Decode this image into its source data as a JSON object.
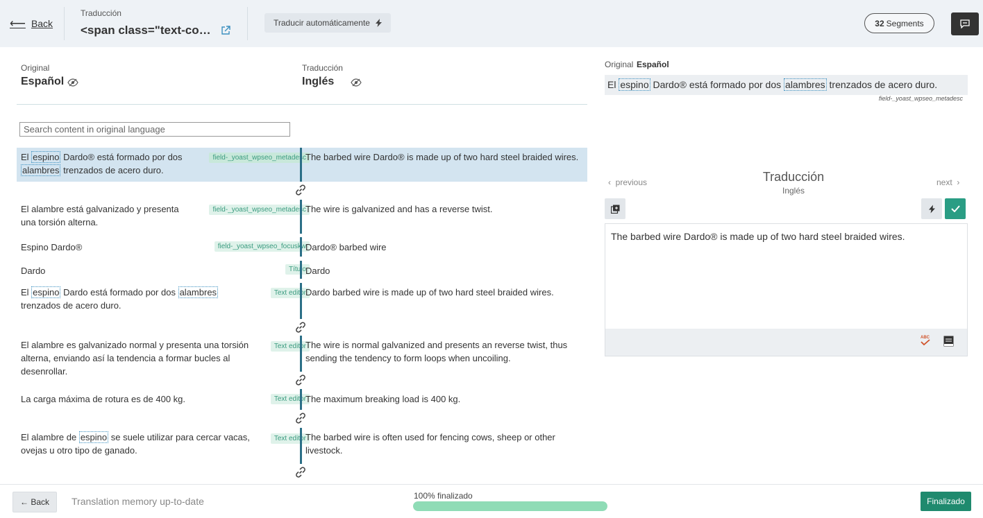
{
  "header": {
    "back_label": "Back",
    "title_small": "Traducción",
    "title_big": "<span class=\"text-copy\">Espino Dardo</span>",
    "auto_translate_label": "Traducir automáticamente",
    "segments_count": "32",
    "segments_label": "Segments"
  },
  "left": {
    "original_label": "Original",
    "original_lang": "Español",
    "translation_label": "Traducción",
    "translation_lang": "Inglés",
    "search_placeholder": "Search content in original language"
  },
  "segments": [
    {
      "src_parts": [
        "El ",
        "espino",
        " Dardo® está formado por dos ",
        "alambres",
        " trenzados de acero duro."
      ],
      "tag": "field-_yoast_wpseo_metadesc",
      "tgt": "The barbed wire Dardo® is made up of two hard steel braided wires."
    },
    {
      "src": "El alambre está galvanizado y presenta una torsión alterna.",
      "tag": "field-_yoast_wpseo_metadesc",
      "tgt": "The wire is galvanized and has a reverse twist."
    },
    {
      "src": "Espino Dardo®",
      "tag": "field-_yoast_wpseo_focuskw",
      "tgt": "Dardo® barbed wire"
    },
    {
      "src": "Dardo",
      "tag": "Título",
      "tgt": "Dardo"
    },
    {
      "src_parts": [
        "El ",
        "espino",
        " Dardo está formado por dos ",
        "alambres",
        " trenzados de acero duro."
      ],
      "tag": "Text editor",
      "tgt": "Dardo barbed wire is made up of two hard steel braided wires."
    },
    {
      "src": "El alambre es galvanizado normal y presenta una torsión alterna, enviando así la tendencia a formar bucles al desenrollar.",
      "tag": "Text editor",
      "tgt": "The wire is normal galvanized and presents an reverse twist, thus sending the tendency to form loops when uncoiling."
    },
    {
      "src": "La carga máxima de rotura es de 400 kg.",
      "tag": "Text editor",
      "tgt": "The maximum breaking load is 400 kg."
    },
    {
      "src_parts": [
        "El alambre de ",
        "espino",
        " se suele utilizar para cercar vacas, ovejas u otro tipo de ganado."
      ],
      "tag": "Text editor",
      "tgt": "The barbed wire is often used for fencing cows, sheep or other livestock."
    }
  ],
  "right": {
    "original_label": "Original",
    "original_lang": "Español",
    "original_parts": [
      "El ",
      "espino",
      " Dardo® está formado por dos ",
      "alambres",
      " trenzados de acero duro."
    ],
    "field_name": "field-_yoast_wpseo_metadesc",
    "previous_label": "previous",
    "next_label": "next",
    "translation_title": "Traducción",
    "translation_lang": "Inglés",
    "editor_text": "The barbed wire Dardo® is made up of two hard steel braided wires.",
    "spell_icon_text": "ABC"
  },
  "footer": {
    "back_label": "← Back",
    "memory_status": "Translation memory up-to-date",
    "progress_label": "100% finalizado",
    "progress_value": 1.0,
    "finalize_label": "Finalizado"
  },
  "colors": {
    "accent": "#2a9d84",
    "link": "#3a8fbf",
    "active_row": "#d3e4f0",
    "progress": "#8fdcb6"
  }
}
